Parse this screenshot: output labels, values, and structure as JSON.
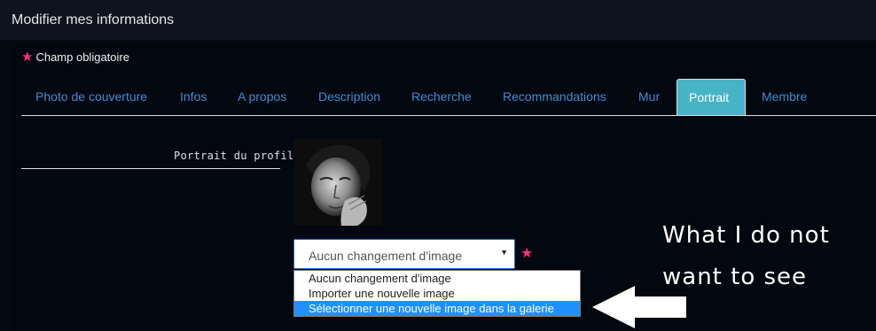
{
  "header": {
    "title": "Modifier mes informations"
  },
  "form": {
    "required_note": "Champ obligatoire",
    "required_icon": "star-icon",
    "required_color": "#ff2d7a"
  },
  "tabs": [
    {
      "label": "Photo de couverture",
      "active": false
    },
    {
      "label": "Infos",
      "active": false
    },
    {
      "label": "A propos",
      "active": false
    },
    {
      "label": "Description",
      "active": false
    },
    {
      "label": "Recherche",
      "active": false
    },
    {
      "label": "Recommandations",
      "active": false
    },
    {
      "label": "Mur",
      "active": false
    },
    {
      "label": "Portrait",
      "active": true
    },
    {
      "label": "Membre",
      "active": false
    }
  ],
  "portrait_field": {
    "label": "Portrait du profil",
    "select": {
      "selected": "Aucun changement d'image",
      "options": [
        "Aucun changement d'image",
        "Importer une nouvelle image",
        "Sélectionner une nouvelle image dans la galerie"
      ],
      "highlighted_index": 2
    }
  },
  "annotation": {
    "line1": "What I do not",
    "line2": "want to see",
    "arrow_icon": "arrow-left-icon"
  },
  "colors": {
    "tab_link": "#3d8ed8",
    "tab_active_bg": "#46b3c7",
    "option_highlight": "#1e90ff"
  }
}
